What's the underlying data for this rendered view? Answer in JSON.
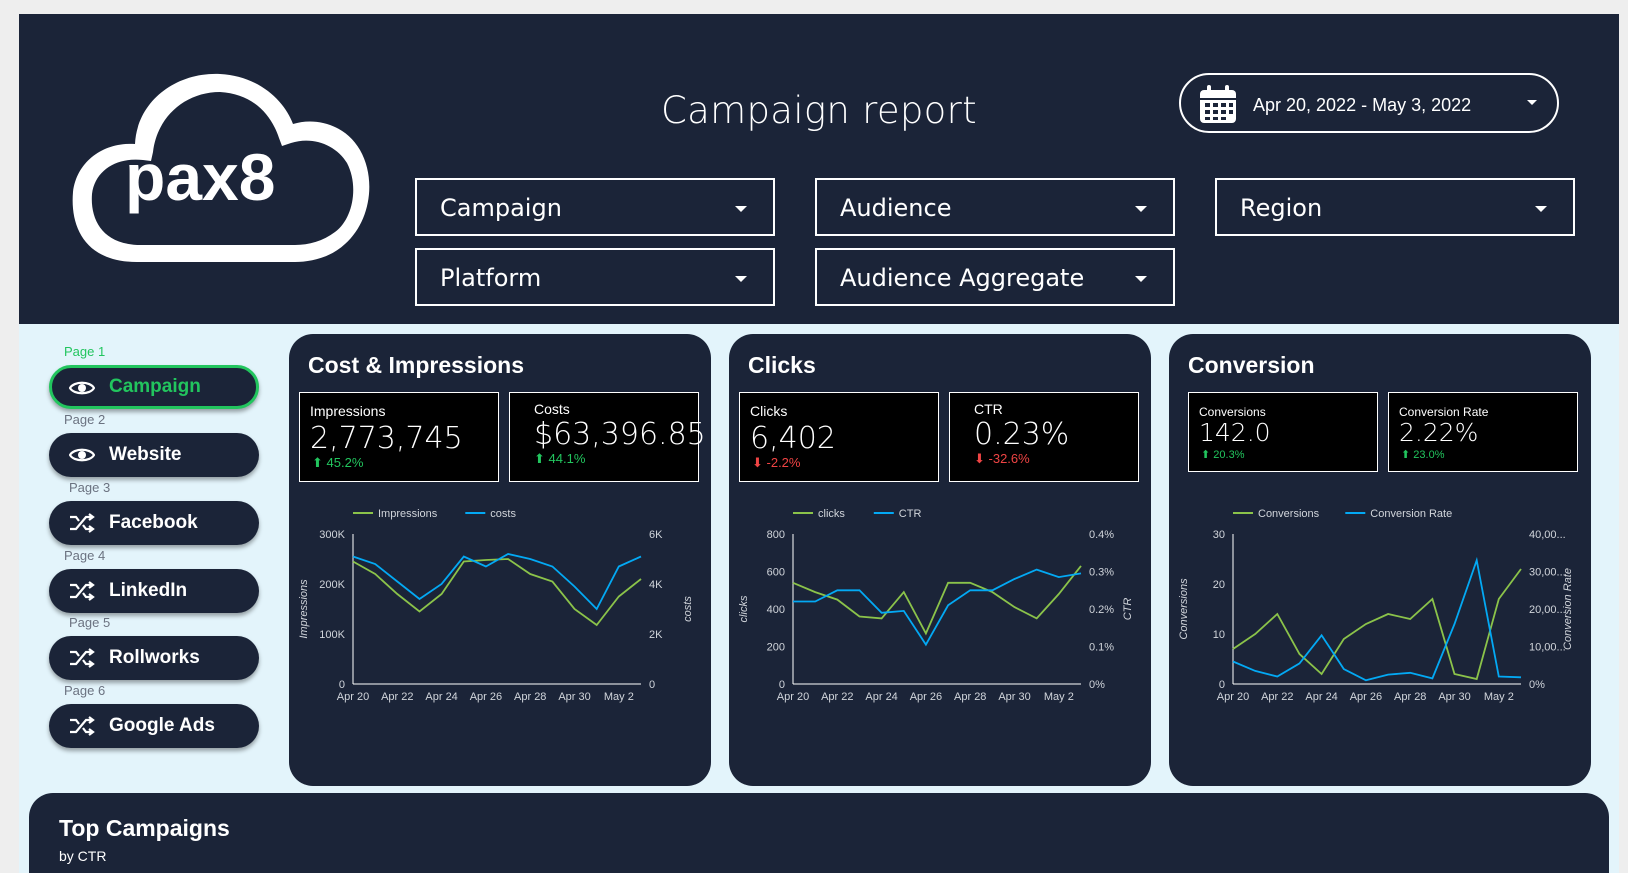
{
  "header": {
    "logo_text": "pax8",
    "title": "Campaign report",
    "date_range": "Apr 20, 2022 - May 3, 2022",
    "filters": [
      "Campaign",
      "Audience",
      "Region",
      "Platform",
      "Audience Aggregate"
    ]
  },
  "nav": {
    "items": [
      {
        "page": "Page 1",
        "label": "Campaign",
        "icon": "eye-icon"
      },
      {
        "page": "Page 2",
        "label": "Website",
        "icon": "eye-icon"
      },
      {
        "page": "Page 3",
        "label": "Facebook",
        "icon": "shuffle-icon"
      },
      {
        "page": "Page 4",
        "label": "LinkedIn",
        "icon": "shuffle-icon"
      },
      {
        "page": "Page 5",
        "label": "Rollworks",
        "icon": "shuffle-icon"
      },
      {
        "page": "Page 6",
        "label": "Google Ads",
        "icon": "shuffle-icon"
      }
    ]
  },
  "cards": [
    {
      "title": "Cost & Impressions",
      "kpis": [
        {
          "label": "Impressions",
          "value": "2,773,745",
          "change": "45.2%",
          "dir": "up"
        },
        {
          "label": "Costs",
          "value": "$63,396.85",
          "change": "44.1%",
          "dir": "up"
        }
      ]
    },
    {
      "title": "Clicks",
      "kpis": [
        {
          "label": "Clicks",
          "value": "6,402",
          "change": "-2.2%",
          "dir": "down"
        },
        {
          "label": "CTR",
          "value": "0.23%",
          "change": "-32.6%",
          "dir": "down"
        }
      ]
    },
    {
      "title": "Conversion",
      "kpis": [
        {
          "label": "Conversions",
          "value": "142.0",
          "change": "20.3%",
          "dir": "up"
        },
        {
          "label": "Conversion Rate",
          "value": "2.22%",
          "change": "23.0%",
          "dir": "up"
        }
      ]
    }
  ],
  "bottom": {
    "title": "Top Campaigns",
    "subtitle": "by  CTR"
  },
  "colors": {
    "navy": "#1b2438",
    "green": "#22c55e",
    "line_green": "#8bc34a",
    "line_blue": "#03a9f4"
  },
  "chart_data": [
    {
      "type": "line",
      "x": [
        "Apr 20",
        "Apr 21",
        "Apr 22",
        "Apr 23",
        "Apr 24",
        "Apr 25",
        "Apr 26",
        "Apr 27",
        "Apr 28",
        "Apr 29",
        "Apr 30",
        "May 1",
        "May 2",
        "May 3"
      ],
      "x_tick_labels": [
        "Apr 20",
        "Apr 22",
        "Apr 24",
        "Apr 26",
        "Apr 28",
        "Apr 30",
        "May 2"
      ],
      "series": [
        {
          "name": "Impressions",
          "axis": "left",
          "color": "#8bc34a",
          "values": [
            245000,
            220000,
            180000,
            145000,
            180000,
            245000,
            248000,
            250000,
            220000,
            205000,
            150000,
            118000,
            175000,
            210000
          ]
        },
        {
          "name": "costs",
          "axis": "right",
          "color": "#03a9f4",
          "values": [
            5100,
            4800,
            4100,
            3400,
            4000,
            5100,
            4700,
            5200,
            5000,
            4700,
            3900,
            3000,
            4700,
            5100
          ]
        }
      ],
      "ylabel_left": "Impressions",
      "ylabel_right": "costs",
      "y_left_ticks": [
        "0",
        "100K",
        "200K",
        "300K"
      ],
      "y_left_lim": [
        0,
        300000
      ],
      "y_right_ticks": [
        "0",
        "2K",
        "4K",
        "6K"
      ],
      "y_right_lim": [
        0,
        6000
      ],
      "legend": "top"
    },
    {
      "type": "line",
      "x": [
        "Apr 20",
        "Apr 21",
        "Apr 22",
        "Apr 23",
        "Apr 24",
        "Apr 25",
        "Apr 26",
        "Apr 27",
        "Apr 28",
        "Apr 29",
        "Apr 30",
        "May 1",
        "May 2",
        "May 3"
      ],
      "x_tick_labels": [
        "Apr 20",
        "Apr 22",
        "Apr 24",
        "Apr 26",
        "Apr 28",
        "Apr 30",
        "May 2"
      ],
      "series": [
        {
          "name": "clicks",
          "axis": "left",
          "color": "#8bc34a",
          "values": [
            540,
            490,
            450,
            360,
            350,
            490,
            270,
            540,
            540,
            490,
            410,
            350,
            480,
            630
          ]
        },
        {
          "name": "CTR",
          "axis": "right",
          "color": "#03a9f4",
          "values": [
            0.22,
            0.22,
            0.25,
            0.25,
            0.19,
            0.195,
            0.105,
            0.21,
            0.25,
            0.25,
            0.28,
            0.305,
            0.285,
            0.295
          ]
        }
      ],
      "ylabel_left": "clicks",
      "ylabel_right": "CTR",
      "y_left_ticks": [
        "0",
        "200",
        "400",
        "600",
        "800"
      ],
      "y_left_lim": [
        0,
        800
      ],
      "y_right_ticks": [
        "0%",
        "0.1%",
        "0.2%",
        "0.3%",
        "0.4%"
      ],
      "y_right_lim": [
        0,
        0.4
      ],
      "legend": "top"
    },
    {
      "type": "line",
      "x": [
        "Apr 20",
        "Apr 21",
        "Apr 22",
        "Apr 23",
        "Apr 24",
        "Apr 25",
        "Apr 26",
        "Apr 27",
        "Apr 28",
        "Apr 29",
        "Apr 30",
        "May 1",
        "May 2",
        "May 3"
      ],
      "x_tick_labels": [
        "Apr 20",
        "Apr 22",
        "Apr 24",
        "Apr 26",
        "Apr 28",
        "Apr 30",
        "May 2"
      ],
      "series": [
        {
          "name": "Conversions",
          "axis": "left",
          "color": "#8bc34a",
          "values": [
            7,
            10,
            14,
            6,
            2,
            9,
            12,
            14,
            13,
            17,
            2,
            1,
            17,
            23
          ]
        },
        {
          "name": "Conversion Rate",
          "axis": "right",
          "color": "#03a9f4",
          "values": [
            6000,
            3500,
            2000,
            5500,
            13000,
            4000,
            1000,
            2500,
            3000,
            1500,
            16000,
            33000,
            2000,
            1800
          ]
        }
      ],
      "ylabel_left": "Conversions",
      "ylabel_right": "Conversion Rate",
      "y_left_ticks": [
        "0",
        "10",
        "20",
        "30"
      ],
      "y_left_lim": [
        0,
        30
      ],
      "y_right_ticks": [
        "0%",
        "10,00...",
        "20,00...",
        "30,00...",
        "40,00..."
      ],
      "y_right_lim": [
        0,
        40000
      ],
      "legend": "top"
    }
  ]
}
